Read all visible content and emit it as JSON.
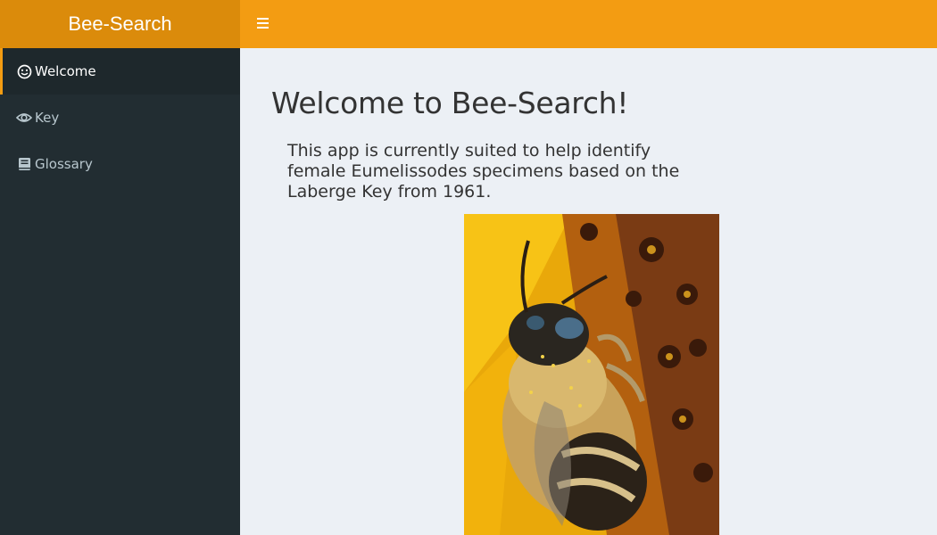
{
  "header": {
    "app_title": "Bee-Search"
  },
  "sidebar": {
    "items": [
      {
        "label": "Welcome",
        "icon": "smile-icon",
        "active": true
      },
      {
        "label": "Key",
        "icon": "eye-icon",
        "active": false
      },
      {
        "label": "Glossary",
        "icon": "book-icon",
        "active": false
      }
    ]
  },
  "main": {
    "title": "Welcome to Bee-Search!",
    "intro": "This app is currently suited to help identify female Eumelissodes specimens based on the Laberge Key from 1961."
  },
  "colors": {
    "accent": "#f39c12",
    "logo_bg": "#db8b0b",
    "sidebar_bg": "#222d32",
    "content_bg": "#ecf0f5"
  }
}
